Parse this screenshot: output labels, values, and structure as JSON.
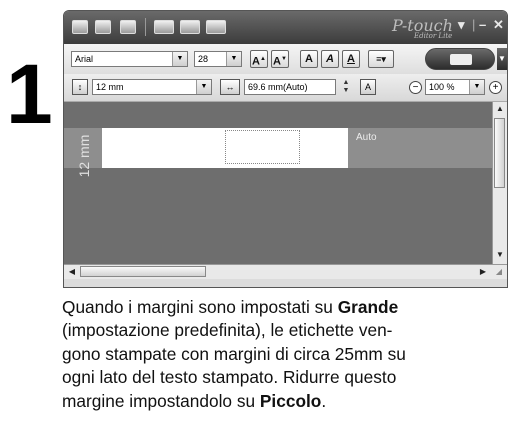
{
  "step_number": "1",
  "window": {
    "logo": "P-touch",
    "logo_sub": "Editor Lite",
    "controls": [
      "▾",
      "|",
      "–",
      "✕"
    ]
  },
  "toolbar": {
    "font_value": "Arial",
    "size_value": "28",
    "font_buttons": [
      "A",
      "A",
      "A",
      "A",
      "A"
    ],
    "tape_width_value": "12 mm",
    "length_value": "69.6 mm(Auto)",
    "zoom_value": "100 %"
  },
  "canvas": {
    "ruler_label": "12 mm",
    "length_label": "Auto"
  },
  "instruction": {
    "line1_pre": "Quando i margini sono impostati su ",
    "line1_bold": "Grande",
    "line2": "(impostazione predefinita), le etichette ven-",
    "line3": "gono stampate con margini di circa 25mm su",
    "line4": "ogni lato del testo stampato. Ridurre questo",
    "line5_pre": "margine impostandolo su ",
    "line5_bold": "Piccolo",
    "line5_post": "."
  }
}
